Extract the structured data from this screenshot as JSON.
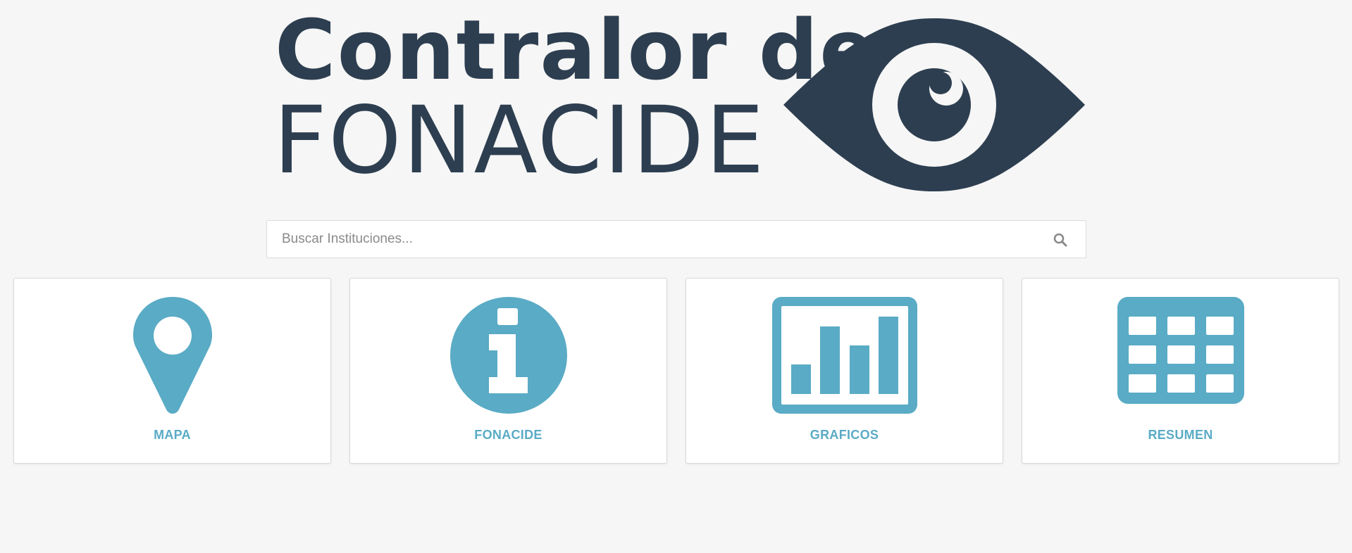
{
  "brand": {
    "line1": "Contralor de",
    "line2": "FONACIDE",
    "logo_color": "#2d3e50",
    "icon": "eye-icon"
  },
  "search": {
    "placeholder": "Buscar Instituciones...",
    "value": "",
    "icon": "search-icon"
  },
  "theme": {
    "accent": "#5aabc5",
    "background": "#f6f6f6"
  },
  "cards": [
    {
      "label": "MAPA",
      "icon": "map-marker-icon"
    },
    {
      "label": "FONACIDE",
      "icon": "info-icon"
    },
    {
      "label": "GRAFICOS",
      "icon": "bar-chart-icon"
    },
    {
      "label": "RESUMEN",
      "icon": "table-grid-icon"
    }
  ]
}
